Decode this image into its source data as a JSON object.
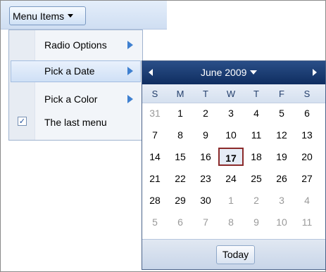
{
  "toolbar": {
    "menu_button_label": "Menu Items"
  },
  "menu": {
    "items": [
      {
        "label": "Radio Options",
        "has_submenu": true
      },
      {
        "label": "Pick a Date",
        "has_submenu": true,
        "active": true
      },
      {
        "label": "Pick a Color",
        "has_submenu": true
      },
      {
        "label": "The last menu",
        "checked": true
      }
    ]
  },
  "calendar": {
    "title": "June 2009",
    "weekdays": [
      "S",
      "M",
      "T",
      "W",
      "T",
      "F",
      "S"
    ],
    "weeks": [
      [
        "31",
        "1",
        "2",
        "3",
        "4",
        "5",
        "6"
      ],
      [
        "7",
        "8",
        "9",
        "10",
        "11",
        "12",
        "13"
      ],
      [
        "14",
        "15",
        "16",
        "17",
        "18",
        "19",
        "20"
      ],
      [
        "21",
        "22",
        "23",
        "24",
        "25",
        "26",
        "27"
      ],
      [
        "28",
        "29",
        "30",
        "1",
        "2",
        "3",
        "4"
      ],
      [
        "5",
        "6",
        "7",
        "8",
        "9",
        "10",
        "11"
      ]
    ],
    "selected_day": "17",
    "today_label": "Today"
  }
}
